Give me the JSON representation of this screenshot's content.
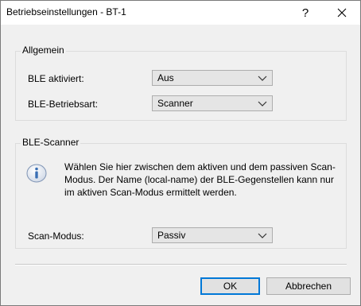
{
  "window": {
    "title": "Betriebseinstellungen - BT-1",
    "help_label": "?"
  },
  "group_general": {
    "title": "Allgemein",
    "ble_enabled": {
      "label": "BLE aktiviert:",
      "value": "Aus"
    },
    "ble_mode": {
      "label": "BLE-Betriebsart:",
      "value": "Scanner"
    }
  },
  "group_scanner": {
    "title": "BLE-Scanner",
    "info_text": "Wählen Sie hier zwischen dem aktiven und dem passiven Scan-Modus. Der Name (local-name) der BLE-Gegenstellen kann nur im aktiven Scan-Modus ermittelt werden.",
    "scan_mode": {
      "label": "Scan-Modus:",
      "value": "Passiv"
    }
  },
  "buttons": {
    "ok": "OK",
    "cancel": "Abbrechen"
  },
  "colors": {
    "accent": "#0078d7",
    "info_icon_blue": "#3a6fb4"
  }
}
